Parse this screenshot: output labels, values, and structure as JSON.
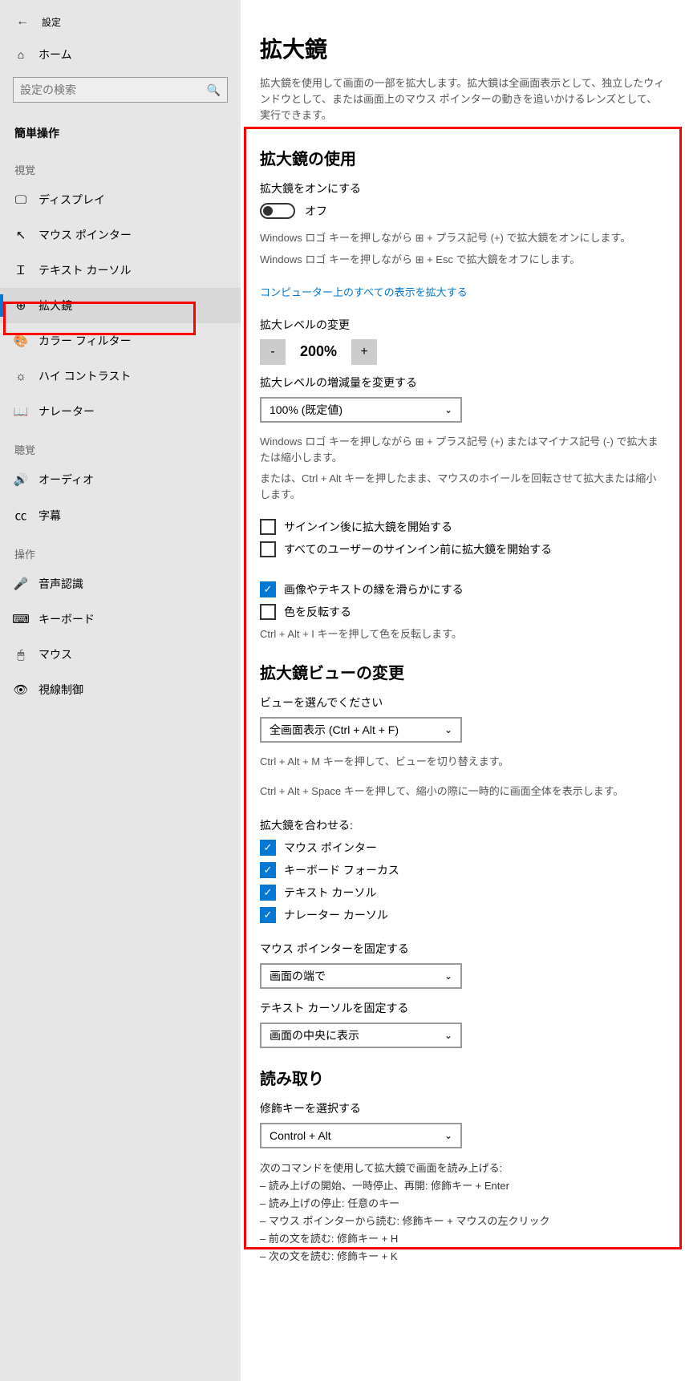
{
  "header": {
    "title": "設定"
  },
  "home": {
    "label": "ホーム"
  },
  "search": {
    "placeholder": "設定の検索"
  },
  "category": "簡単操作",
  "groups": {
    "visual": {
      "heading": "視覚",
      "items": [
        "ディスプレイ",
        "マウス ポインター",
        "テキスト カーソル",
        "拡大鏡",
        "カラー フィルター",
        "ハイ コントラスト",
        "ナレーター"
      ]
    },
    "hearing": {
      "heading": "聴覚",
      "items": [
        "オーディオ",
        "字幕"
      ]
    },
    "interaction": {
      "heading": "操作",
      "items": [
        "音声認識",
        "キーボード",
        "マウス",
        "視線制御"
      ]
    }
  },
  "page": {
    "title": "拡大鏡",
    "description": "拡大鏡を使用して画面の一部を拡大します。拡大鏡は全画面表示として、独立したウィンドウとして、または画面上のマウス ポインターの動きを追いかけるレンズとして、実行できます。",
    "use_section": {
      "heading": "拡大鏡の使用",
      "toggle_label": "拡大鏡をオンにする",
      "toggle_state": "オフ",
      "hint_on": "Windows ロゴ キーを押しながら ⊞ + プラス記号 (+) で拡大鏡をオンにします。",
      "hint_off": "Windows ロゴ キーを押しながら ⊞ + Esc で拡大鏡をオフにします。",
      "link": "コンピューター上のすべての表示を拡大する",
      "zoom_label": "拡大レベルの変更",
      "zoom_value": "200%",
      "increment_label": "拡大レベルの増減量を変更する",
      "increment_select": "100% (既定値)",
      "hint_zoom1": "Windows ロゴ キーを押しながら ⊞ + プラス記号 (+) またはマイナス記号 (-) で拡大または縮小します。",
      "hint_zoom2": "または、Ctrl + Alt キーを押したまま、マウスのホイールを回転させて拡大または縮小します。",
      "checkboxes": [
        {
          "label": "サインイン後に拡大鏡を開始する",
          "checked": false
        },
        {
          "label": "すべてのユーザーのサインイン前に拡大鏡を開始する",
          "checked": false
        },
        {
          "label": "画像やテキストの縁を滑らかにする",
          "checked": true
        },
        {
          "label": "色を反転する",
          "checked": false
        }
      ],
      "invert_hint": "Ctrl + Alt + I キーを押して色を反転します。"
    },
    "view_section": {
      "heading": "拡大鏡ビューの変更",
      "select_label": "ビューを選んでください",
      "select_value": "全画面表示 (Ctrl + Alt + F)",
      "hint1": "Ctrl + Alt + M キーを押して、ビューを切り替えます。",
      "hint2": "Ctrl + Alt + Space キーを押して、縮小の際に一時的に画面全体を表示します。",
      "follow_label": "拡大鏡を合わせる:",
      "follow": [
        {
          "label": "マウス ポインター",
          "checked": true
        },
        {
          "label": "キーボード フォーカス",
          "checked": true
        },
        {
          "label": "テキスト カーソル",
          "checked": true
        },
        {
          "label": "ナレーター カーソル",
          "checked": true
        }
      ],
      "mouse_fix_label": "マウス ポインターを固定する",
      "mouse_fix_value": "画面の端で",
      "text_fix_label": "テキスト カーソルを固定する",
      "text_fix_value": "画面の中央に表示"
    },
    "read_section": {
      "heading": "読み取り",
      "modifier_label": "修飾キーを選択する",
      "modifier_value": "Control + Alt",
      "commands_intro": "次のコマンドを使用して拡大鏡で画面を読み上げる:",
      "commands": [
        "– 読み上げの開始、一時停止、再開: 修飾キー + Enter",
        "– 読み上げの停止: 任意のキー",
        "– マウス ポインターから読む: 修飾キー + マウスの左クリック",
        "– 前の文を読む: 修飾キー + H",
        "– 次の文を読む: 修飾キー + K"
      ]
    }
  }
}
